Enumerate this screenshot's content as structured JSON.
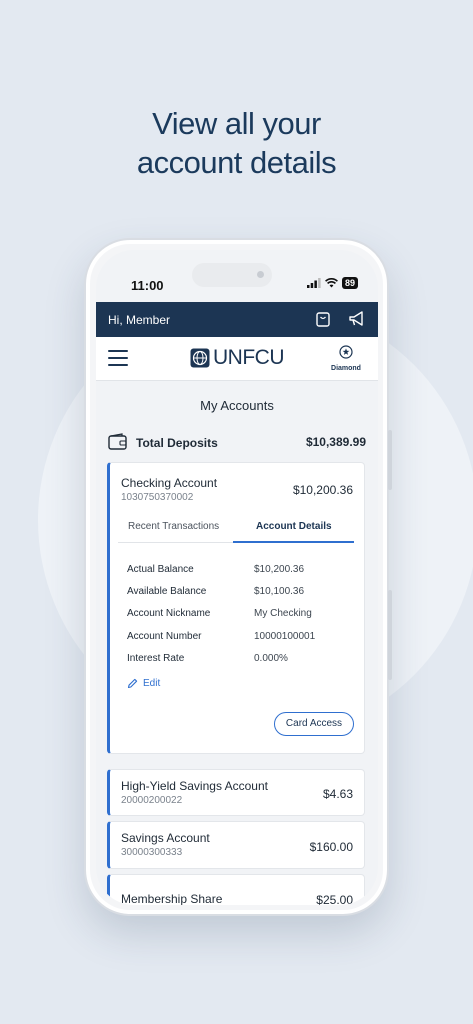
{
  "headline": {
    "line1": "View all your",
    "line2": "account details"
  },
  "status_bar": {
    "time": "11:00",
    "battery": "89"
  },
  "topbar": {
    "greeting": "Hi, Member",
    "icons": [
      "bag-icon",
      "megaphone-icon"
    ],
    "color": "#1c3553"
  },
  "navbar": {
    "brand": "UNFCU",
    "tier": "Diamond"
  },
  "page_title": "My Accounts",
  "total_deposits": {
    "label": "Total Deposits",
    "value": "$10,389.99"
  },
  "checking": {
    "name": "Checking Account",
    "number": "1030750370002",
    "balance": "$10,200.36",
    "tabs": [
      "Recent Transactions",
      "Account Details"
    ],
    "active_tab": "Account Details",
    "details": [
      {
        "label": "Actual Balance",
        "value": "$10,200.36"
      },
      {
        "label": "Available Balance",
        "value": "$10,100.36"
      },
      {
        "label": "Account Nickname",
        "value": "My Checking"
      },
      {
        "label": "Account Number",
        "value": "10000100001"
      },
      {
        "label": "Interest Rate",
        "value": "0.000%"
      }
    ],
    "edit_label": "Edit",
    "card_access_label": "Card Access"
  },
  "accounts": [
    {
      "name": "High-Yield Savings Account",
      "number": "20000200022",
      "balance": "$4.63"
    },
    {
      "name": "Savings Account",
      "number": "30000300333",
      "balance": "$160.00"
    },
    {
      "name": "Membership Share",
      "number": "",
      "balance": "$25.00"
    }
  ],
  "colors": {
    "accent": "#2f6fcf",
    "navy": "#1c3553",
    "background": "#e3e9f1"
  }
}
